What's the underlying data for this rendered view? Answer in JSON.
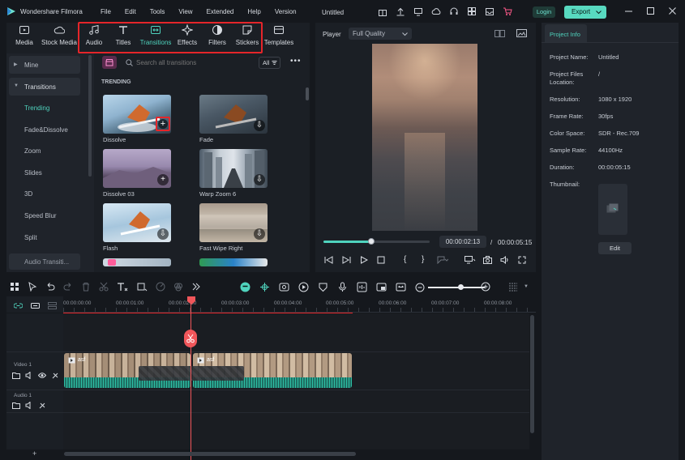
{
  "app": {
    "name": "Wondershare Filmora",
    "project_title": "Untitled",
    "login": "Login",
    "export": "Export"
  },
  "menu": [
    "File",
    "Edit",
    "Tools",
    "View",
    "Extended",
    "Help",
    "Version"
  ],
  "toolbar": [
    {
      "label": "Media",
      "icon": "media-icon"
    },
    {
      "label": "Stock Media",
      "icon": "cloud-icon"
    },
    {
      "label": "Audio",
      "icon": "music-note-icon"
    },
    {
      "label": "Titles",
      "icon": "text-icon"
    },
    {
      "label": "Transitions",
      "icon": "transitions-icon"
    },
    {
      "label": "Effects",
      "icon": "sparkle-icon"
    },
    {
      "label": "Filters",
      "icon": "filter-icon"
    },
    {
      "label": "Stickers",
      "icon": "sticker-icon"
    },
    {
      "label": "Templates",
      "icon": "template-icon"
    }
  ],
  "colors": {
    "accent": "#4fd3bd",
    "highlight": "#e5252a",
    "playhead": "#f0565a",
    "bg": "#15181d",
    "panel": "#22262d"
  },
  "sidebar": {
    "items": [
      "Mine",
      "Transitions",
      "Trending",
      "Fade&Dissolve",
      "Zoom",
      "Slides",
      "3D",
      "Speed Blur",
      "Split",
      "Audio Transiti..."
    ]
  },
  "browser": {
    "search_placeholder": "Search all transitions",
    "filter_label": "All",
    "section": "TRENDING",
    "items": [
      "Dissolve",
      "Fade",
      "Dissolve 03",
      "Warp Zoom 6",
      "Flash",
      "Fast Wipe Right"
    ]
  },
  "player": {
    "label": "Player",
    "quality": "Full Quality",
    "current_time": "00:00:02:13",
    "separator": "/",
    "total_time": "00:00:05:15",
    "progress": 0.45
  },
  "project_info": {
    "tab": "Project Info",
    "rows": [
      {
        "label": "Project Name:",
        "value": "Untitled"
      },
      {
        "label": "Project Files Location:",
        "value": "/"
      },
      {
        "label": "Resolution:",
        "value": "1080 x 1920"
      },
      {
        "label": "Frame Rate:",
        "value": "30fps"
      },
      {
        "label": "Color Space:",
        "value": "SDR - Rec.709"
      },
      {
        "label": "Sample Rate:",
        "value": "44100Hz"
      },
      {
        "label": "Duration:",
        "value": "00:00:05:15"
      }
    ],
    "thumbnail_label": "Thumbnail:",
    "edit": "Edit"
  },
  "timeline": {
    "ruler": [
      "00:00:00:00",
      "00:00:01:00",
      "00:00:02:00",
      "00:00:03:00",
      "00:00:04:00",
      "00:00:05:00",
      "00:00:06:00",
      "00:00:07:00",
      "00:00:08:00"
    ],
    "tracks": {
      "video": "Video 1",
      "audio": "Audio 1"
    },
    "clip1_name": "asf",
    "clip2_name": "asf"
  }
}
